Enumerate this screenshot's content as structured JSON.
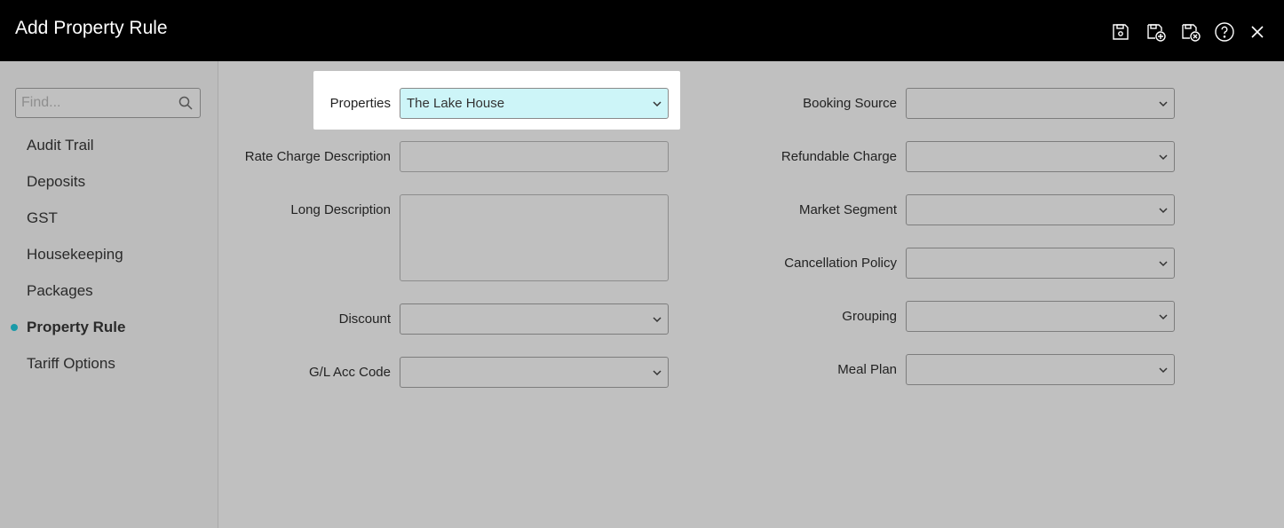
{
  "header": {
    "title": "Add Property Rule",
    "icons": [
      "save-icon",
      "save-and-new-icon",
      "save-and-close-icon",
      "help-icon",
      "close-icon"
    ]
  },
  "sidebar": {
    "search_placeholder": "Find...",
    "items": [
      {
        "label": "Audit Trail"
      },
      {
        "label": "Deposits"
      },
      {
        "label": "GST"
      },
      {
        "label": "Housekeeping"
      },
      {
        "label": "Packages"
      },
      {
        "label": "Property Rule",
        "active": true
      },
      {
        "label": "Tariff Options"
      }
    ]
  },
  "form": {
    "left": {
      "properties": {
        "label": "Properties",
        "value": "The Lake House"
      },
      "rate_charge_description": {
        "label": "Rate Charge Description",
        "value": ""
      },
      "long_description": {
        "label": "Long Description",
        "value": ""
      },
      "discount": {
        "label": "Discount",
        "value": ""
      },
      "gl_acc_code": {
        "label": "G/L Acc Code",
        "value": ""
      }
    },
    "right": {
      "booking_source": {
        "label": "Booking Source",
        "value": ""
      },
      "refundable_charge": {
        "label": "Refundable Charge",
        "value": ""
      },
      "market_segment": {
        "label": "Market Segment",
        "value": ""
      },
      "cancellation_policy": {
        "label": "Cancellation Policy",
        "value": ""
      },
      "grouping": {
        "label": "Grouping",
        "value": ""
      },
      "meal_plan": {
        "label": "Meal Plan",
        "value": ""
      }
    }
  },
  "colors": {
    "header_bg": "#000000",
    "body_bg": "#c0c0c0",
    "selected_field_bg": "#cdf5f8",
    "active_dot": "#1a9aa8"
  }
}
